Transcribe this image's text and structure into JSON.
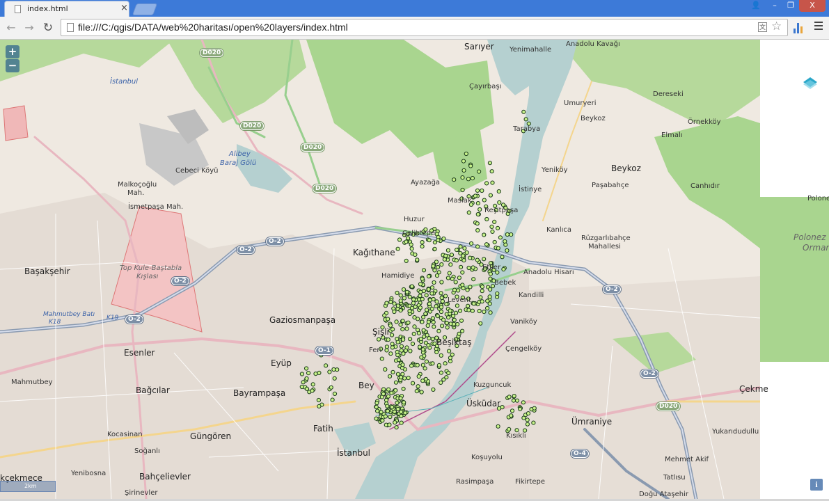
{
  "browser": {
    "tab_title": "index.html",
    "tab_close": "×",
    "url": "file:///C:/qgis/DATA/web%20haritası/open%20layers/index.html",
    "back": "←",
    "forward": "→",
    "reload": "↻",
    "star": "☆",
    "translate": "文",
    "window_user": "👤",
    "window_min": "–",
    "window_max": "❐",
    "window_close": "X"
  },
  "map": {
    "zoom_in": "+",
    "zoom_out": "−",
    "scale": "2km",
    "attribution": "i",
    "labels": {
      "sariyer": "Sarıyer",
      "yenimahalle": "Yenimahalle",
      "anadolu_kavagi": "Anadolu Kavağı",
      "istanbul_nw": "İstanbul",
      "cayirbasi": "Çayırbaşı",
      "umuryeri": "Umuryeri",
      "dereseki": "Dereseki",
      "beykoz_small": "Beykoz",
      "ornekkoy": "Örnekköy",
      "elmali": "Elmalı",
      "tarabya": "Tarabya",
      "alibey": "Alibey",
      "baraj_golu": "Baraj Gölü",
      "cebeci": "Cebeci Köyü",
      "yenikoy": "Yeniköy",
      "beykoz": "Beykoz",
      "malkocoglu": "Malkoçoğlu",
      "mah": "Mah.",
      "ayazaga": "Ayazağa",
      "istinye": "İstinye",
      "pasabahce": "Paşabahçe",
      "canhidir": "Canhıdır",
      "ismetpasa": "İsmetpaşa Mah.",
      "maslak": "Maslak",
      "resitpasa": "Reşitpaşa",
      "polonez": "Polonez",
      "huzur": "Huzur",
      "celiktepe": "Çeliktepe",
      "kanlica": "Kanlıca",
      "ruzgarli": "Rüzgarlıbahçe",
      "mahallesi": "Mahallesi",
      "polonez_ormani": "Polonez",
      "ormani": "Ormanı",
      "kagithane": "Kağıthane",
      "basaksehir": "Başakşehir",
      "topkule": "Top Kule-Baştabla",
      "kislasi": "Kışlası",
      "etiler": "Etiler",
      "anadolu_hisari": "Anadolu Hisarı",
      "hamidiye": "Hamidiye",
      "bebek": "Bebek",
      "kandilli": "Kandilli",
      "mahmutbey_bati": "Mahmutbey Batı",
      "k18": "K18",
      "k19": "K19",
      "gazi": "Gaziosmanpaşa",
      "levent": "Levent",
      "vanikoy": "Vaniköy",
      "sisli": "Şişli",
      "feri": "Feri",
      "besiktas": "Beşiktaş",
      "esenler": "Esenler",
      "eyup": "Eyüp",
      "cengelkoy": "Çengelköy",
      "mahmutbey": "Mahmutbey",
      "bagcilar": "Bağcılar",
      "beyoglu": "Bey",
      "kuzguncuk": "Kuzguncuk",
      "bayrampasa": "Bayrampaşa",
      "cekme": "Çekme",
      "uskudar": "Üsküdar",
      "fatih": "Fatih",
      "umraniye": "Ümraniye",
      "kocasinan": "Kocasinan",
      "gungoren": "Güngören",
      "yukaridudullu": "Yukarıdudullu",
      "soganli": "Soğanlı",
      "kisikli": "Kısıklı",
      "istanbul": "İstanbul",
      "kosuyolu": "Koşuyolu",
      "mehmet_akif": "Mehmet Akif",
      "yenibosna": "Yenibosna",
      "bahcelievler": "Bahçelievler",
      "tatlisu": "Tatlısu",
      "kucukcekmece": "kçekmece",
      "rasimpasa": "Rasimpaşa",
      "fikirtepe": "Fikirtepe",
      "sirinevler": "Şirinevler",
      "dogu_atasehir": "Doğu Ataşehir"
    },
    "shields": {
      "d020_a": "D020",
      "d020_b": "D020",
      "d020_c": "D020",
      "d020_d": "D020",
      "d020_e": "D020",
      "o2_a": "O-2",
      "o2_b": "O-2",
      "o2_c": "O-2",
      "o2_d": "O-2",
      "o2_e": "O-2",
      "o2_f": "O-2",
      "o4": "O-4",
      "o1": "O-1"
    }
  }
}
